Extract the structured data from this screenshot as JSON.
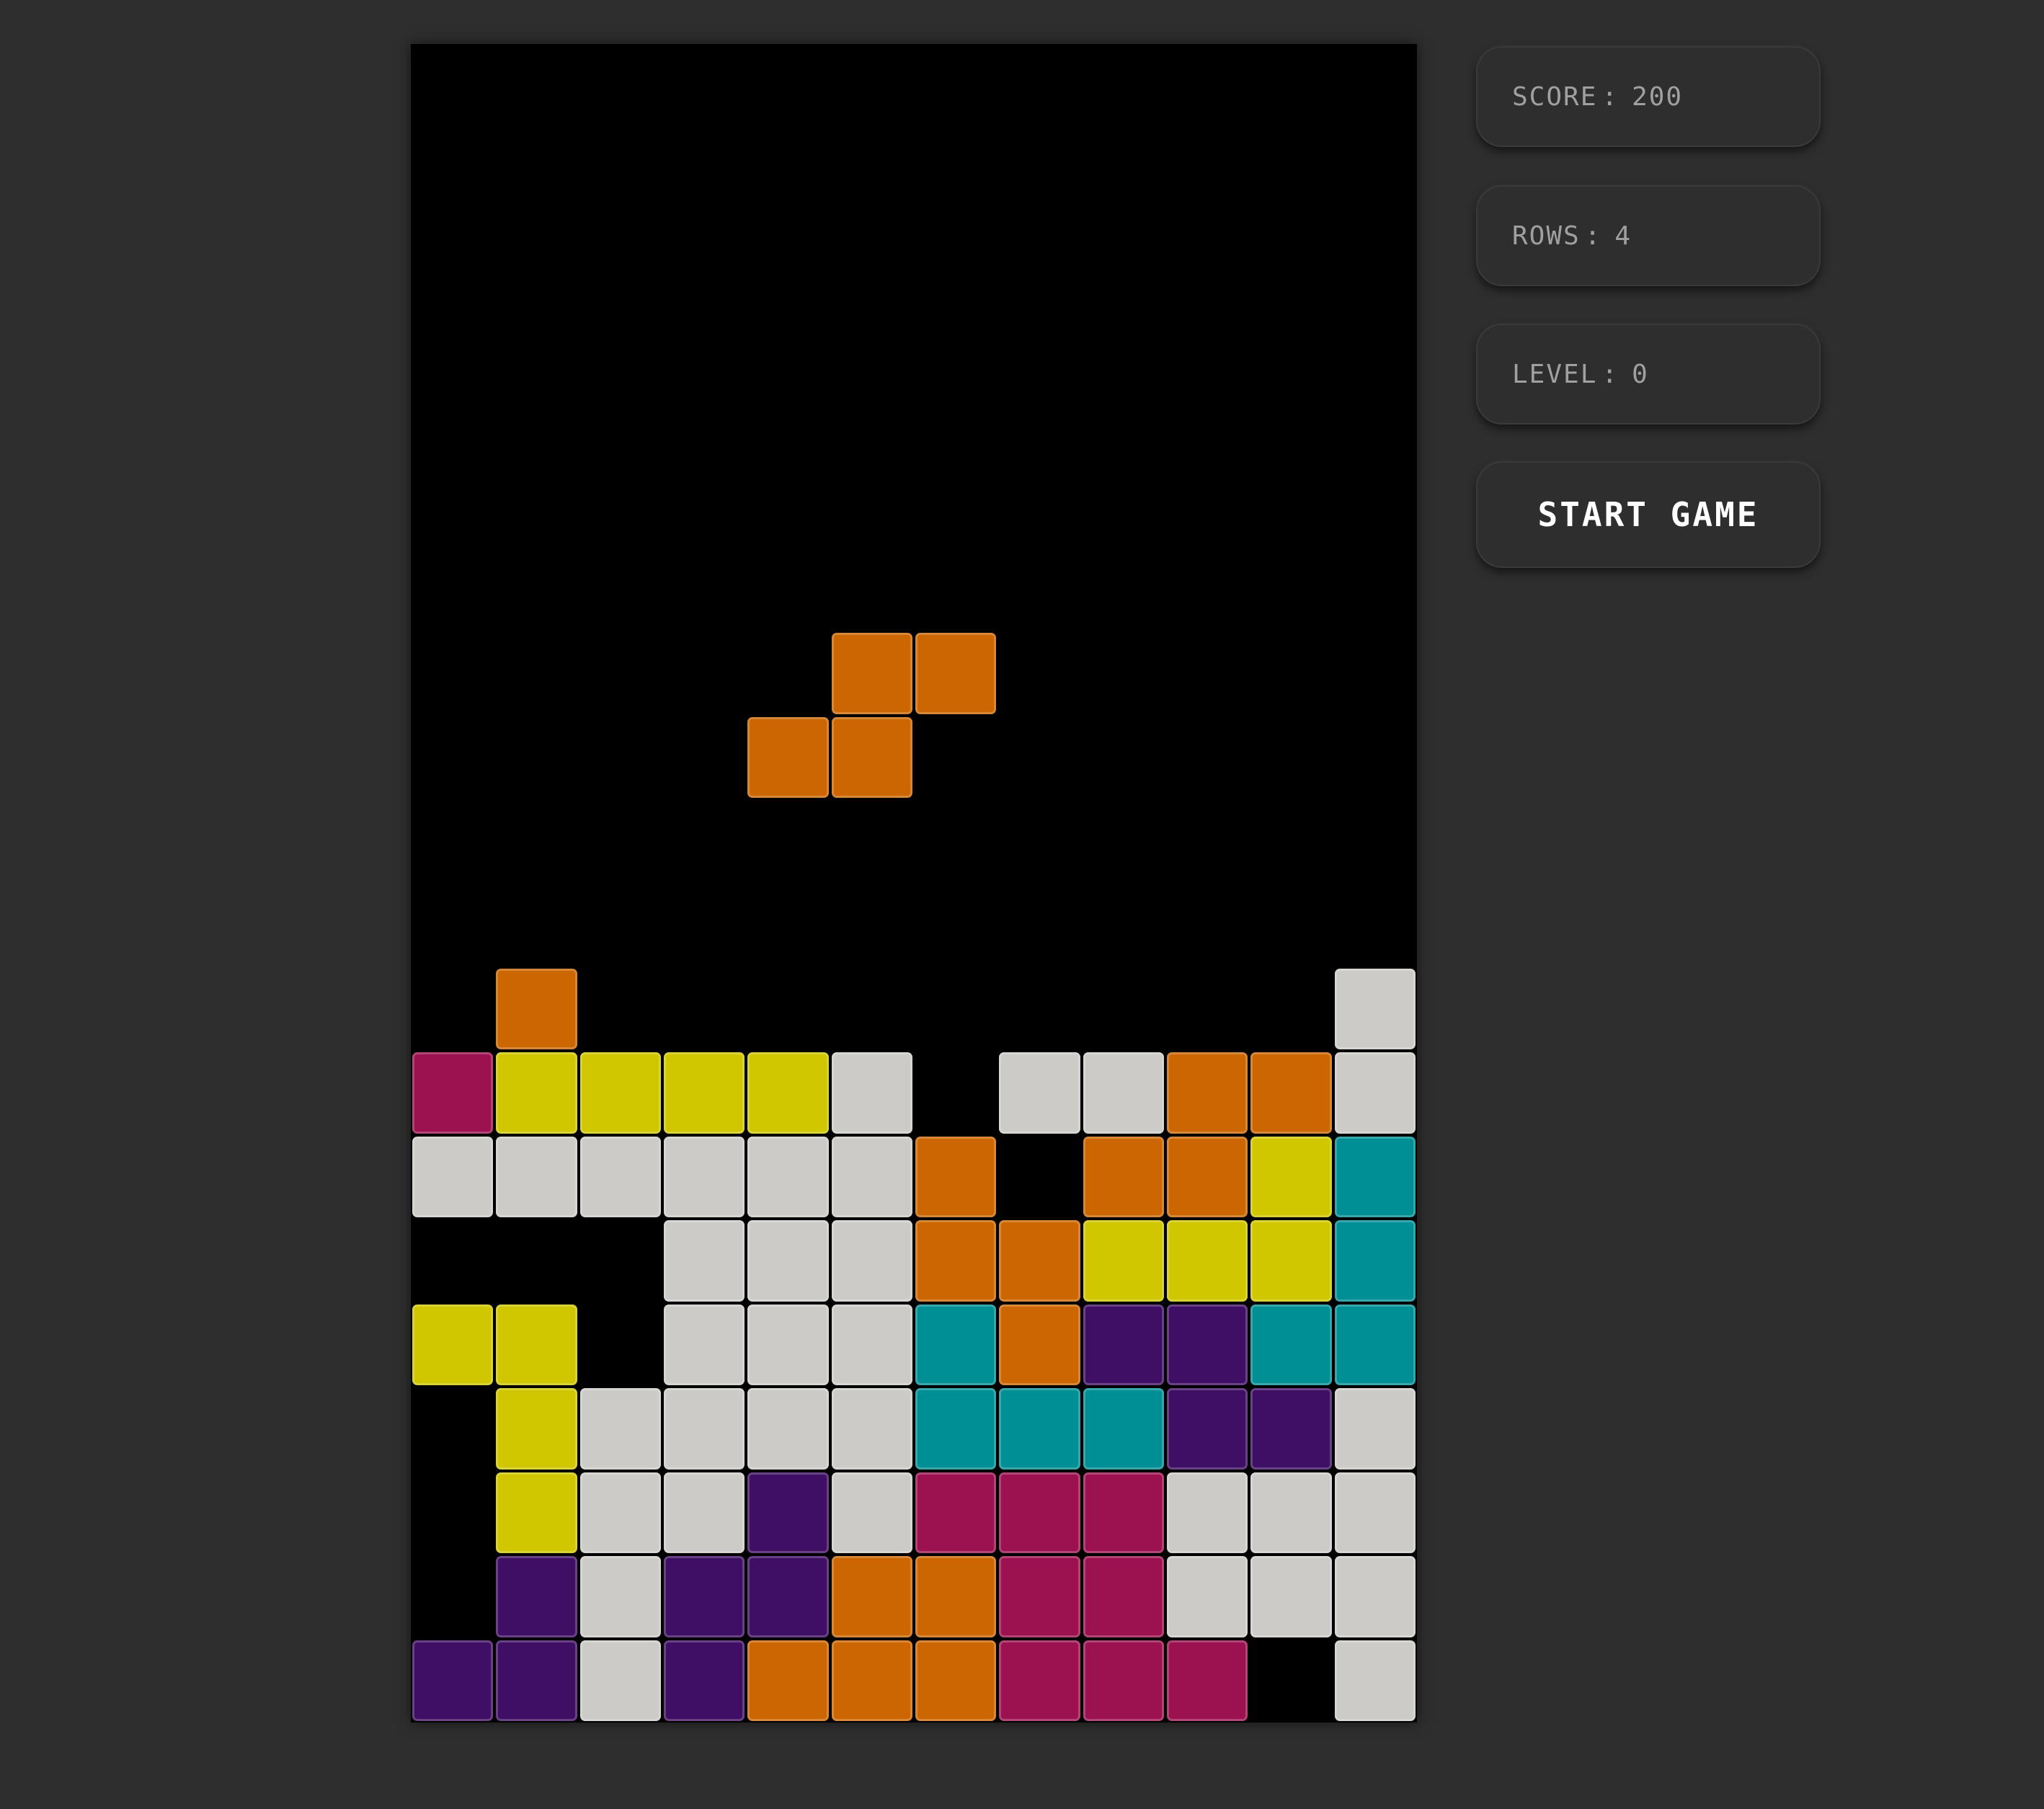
{
  "sidebar": {
    "score": {
      "label": "SCORE",
      "sep": ":",
      "value": "200"
    },
    "rows": {
      "label": "ROWS",
      "sep": ":",
      "value": "4"
    },
    "level": {
      "label": "LEVEL",
      "sep": ":",
      "value": "0"
    },
    "start_button": {
      "label": "START GAME"
    }
  },
  "colors": {
    "O": "#cc6600",
    "Y": "#d0c700",
    "W": "#cccbc7",
    "T": "#008f95",
    "P": "#3f0e65",
    "M": "#9c1150"
  },
  "board": {
    "columns": 12,
    "rows": 20,
    "active_piece": {
      "color": "O",
      "cells": [
        [
          7,
          5
        ],
        [
          7,
          6
        ],
        [
          8,
          4
        ],
        [
          8,
          5
        ]
      ]
    },
    "grid": [
      "............",
      "............",
      "............",
      "............",
      "............",
      "............",
      "............",
      "............",
      "............",
      "............",
      "............",
      ".O.........W",
      "MYYYYW.WWOOW",
      "WWWWWWO.OOYT",
      "...WWWOOYYYT",
      "YY.WWWTOPPTT",
      ".YWWWWTTTPPW",
      ".YWWPWMMMWWW",
      ".PWPPOOMMWWW",
      "PPWPOOOMMM.W"
    ]
  }
}
